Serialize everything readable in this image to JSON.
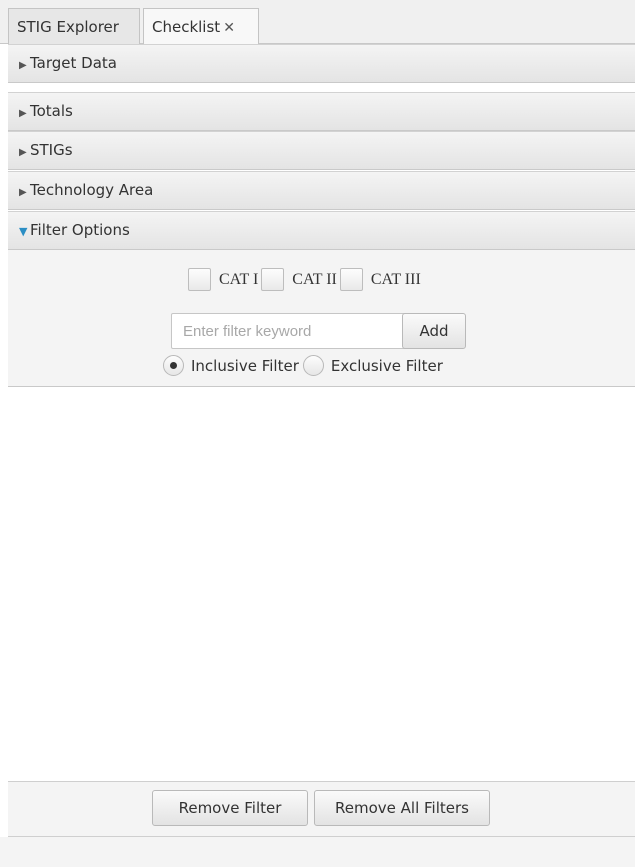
{
  "tabs": [
    {
      "label": "STIG Explorer",
      "active": false
    },
    {
      "label": "Checklist",
      "active": true,
      "close": "✕"
    }
  ],
  "panes": [
    {
      "title": "Target Data",
      "expanded": false
    },
    {
      "title": "Totals",
      "expanded": false
    },
    {
      "title": "STIGs",
      "expanded": false
    },
    {
      "title": "Technology Area",
      "expanded": false
    },
    {
      "title": "Filter Options",
      "expanded": true
    }
  ],
  "filter": {
    "categories": [
      {
        "label": "CAT I",
        "checked": false
      },
      {
        "label": "CAT II",
        "checked": false
      },
      {
        "label": "CAT III",
        "checked": false
      }
    ],
    "keyword_placeholder": "Enter filter keyword",
    "keyword_value": "",
    "add_label": "Add",
    "modes": [
      {
        "label": "Inclusive Filter",
        "selected": true
      },
      {
        "label": "Exclusive Filter",
        "selected": false
      }
    ]
  },
  "footer": {
    "remove_label": "Remove Filter",
    "remove_all_label": "Remove All Filters"
  },
  "icons": {
    "collapsed": "chevron-right-icon",
    "expanded": "chevron-down-icon",
    "expanded_color": "#2b8ec4"
  }
}
